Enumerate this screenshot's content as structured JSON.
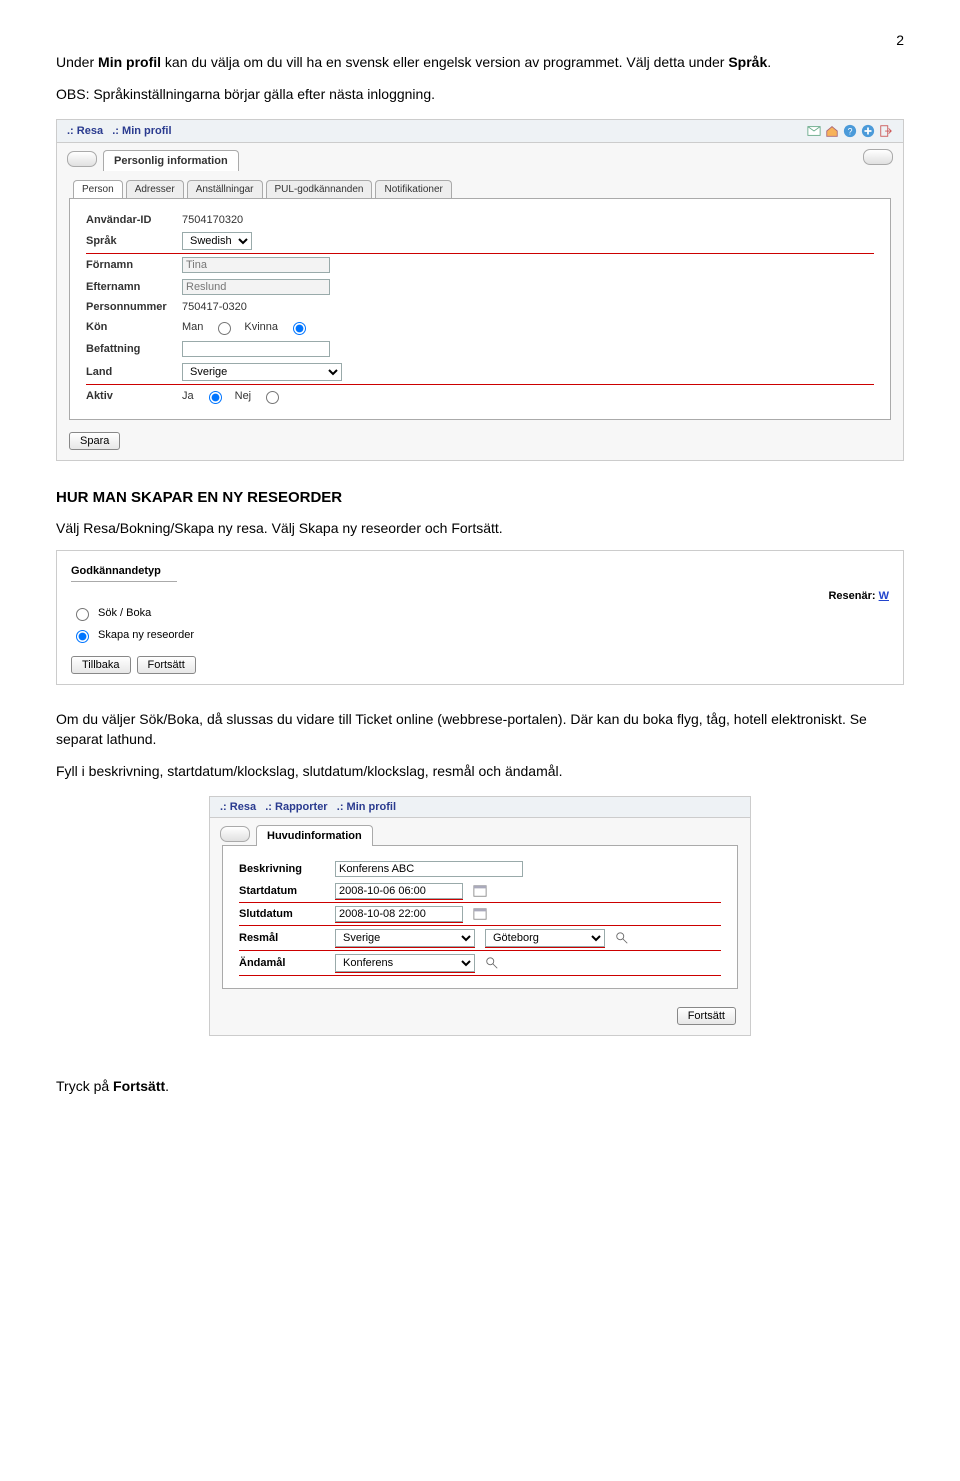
{
  "page_number": "2",
  "body": {
    "p1_pre": "Under ",
    "p1_b1": "Min profil",
    "p1_mid": " kan du välja om du vill ha en svensk eller engelsk version av programmet. Välj detta under ",
    "p1_b2": "Språk",
    "p1_post": ".",
    "p2": "OBS: Språkinställningarna börjar gälla efter nästa inloggning.",
    "h1": "HUR MAN SKAPAR EN NY RESEORDER",
    "p3": "Välj Resa/Bokning/Skapa ny resa. Välj Skapa ny reseorder och Fortsätt.",
    "p4": "Om du väljer Sök/Boka, då slussas du vidare till Ticket online (webbrese-portalen). Där kan du boka flyg, tåg, hotell elektroniskt. Se separat lathund.",
    "p5": "Fyll i beskrivning, startdatum/klockslag, slutdatum/klockslag, resmål och ändamål.",
    "p6_pre": "Tryck på ",
    "p6_b": "Fortsätt",
    "p6_post": "."
  },
  "ss1": {
    "breadcrumb1": ".: Resa",
    "breadcrumb2": ".: Min profil",
    "section_tab": "Personlig information",
    "tabs": [
      "Person",
      "Adresser",
      "Anställningar",
      "PUL-godkännanden",
      "Notifikationer"
    ],
    "labels": {
      "userid": "Användar-ID",
      "sprak": "Språk",
      "fornamn": "Förnamn",
      "efternamn": "Efternamn",
      "pnr": "Personnummer",
      "kon": "Kön",
      "befattning": "Befattning",
      "land": "Land",
      "aktiv": "Aktiv"
    },
    "values": {
      "userid": "7504170320",
      "sprak": "Swedish",
      "fornamn": "Tina",
      "efternamn": "Reslund",
      "pnr": "750417-0320",
      "kon_man": "Man",
      "kon_kvinna": "Kvinna",
      "land": "Sverige",
      "aktiv_ja": "Ja",
      "aktiv_nej": "Nej"
    },
    "save": "Spara"
  },
  "ss2": {
    "title": "Godkännandetyp",
    "resenar_label": "Resenär:",
    "resenar_link": "W",
    "opt1": "Sök / Boka",
    "opt2": "Skapa ny reseorder",
    "btn_back": "Tillbaka",
    "btn_fwd": "Fortsätt"
  },
  "ss3": {
    "bc1": ".: Resa",
    "bc2": ".: Rapporter",
    "bc3": ".: Min profil",
    "section_tab": "Huvudinformation",
    "labels": {
      "besk": "Beskrivning",
      "start": "Startdatum",
      "slut": "Slutdatum",
      "resmal": "Resmål",
      "andamal": "Ändamål"
    },
    "values": {
      "besk": "Konferens ABC",
      "start": "2008-10-06 06:00",
      "slut": "2008-10-08 22:00",
      "resmal_land": "Sverige",
      "resmal_stad": "Göteborg",
      "andamal": "Konferens"
    },
    "btn_fwd": "Fortsätt"
  }
}
